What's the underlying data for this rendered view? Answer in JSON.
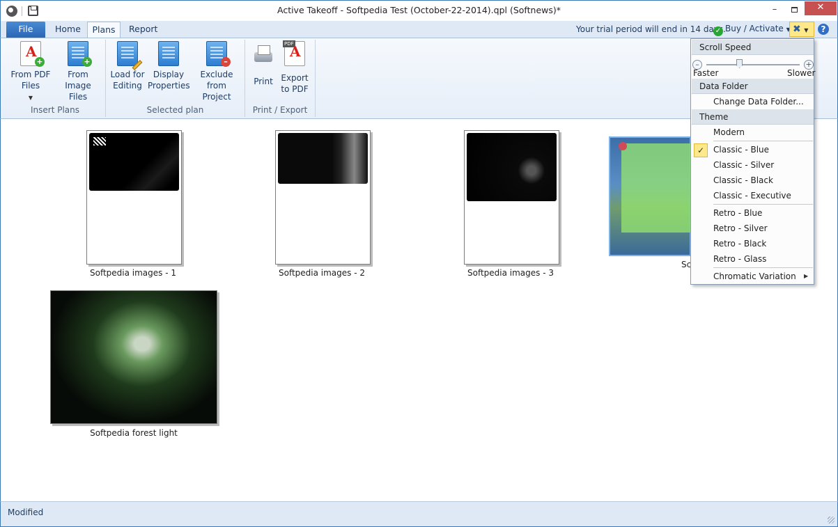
{
  "window": {
    "title": "Active Takeoff - Softpedia Test (October-22-2014).qpl (Softnews)*"
  },
  "tabs": [
    {
      "label": "File"
    },
    {
      "label": "Home"
    },
    {
      "label": "Plans"
    },
    {
      "label": "Report"
    }
  ],
  "trial_text": "Your trial period will end in 14 days.",
  "buy_label": "Buy / Activate",
  "ribbon": {
    "groups": [
      {
        "label": "Insert Plans",
        "buttons": [
          {
            "l1": "From PDF",
            "l2": "Files"
          },
          {
            "l1": "From Image",
            "l2": "Files"
          }
        ]
      },
      {
        "label": "Selected plan",
        "buttons": [
          {
            "l1": "Load for",
            "l2": "Editing"
          },
          {
            "l1": "Display",
            "l2": "Properties"
          },
          {
            "l1": "Exclude from",
            "l2": "Project"
          }
        ]
      },
      {
        "label": "Print / Export",
        "buttons": [
          {
            "l1": "Print",
            "l2": ""
          },
          {
            "l1": "Export",
            "l2": "to PDF"
          }
        ]
      }
    ],
    "pdf_badge": "PDF"
  },
  "thumbnails": [
    {
      "caption": "Softpedia images - 1"
    },
    {
      "caption": "Softpedia images - 2"
    },
    {
      "caption": "Softpedia images - 3"
    },
    {
      "caption": "Sc"
    },
    {
      "caption": "Softpedia forest light"
    }
  ],
  "status": {
    "text": "Modified"
  },
  "menu": {
    "scroll_speed": "Scroll Speed",
    "faster": "Faster",
    "slower": "Slower",
    "data_folder": "Data Folder",
    "change_data_folder": "Change Data Folder...",
    "theme": "Theme",
    "themes": [
      "Modern",
      "Classic - Blue",
      "Classic - Silver",
      "Classic - Black",
      "Classic - Executive",
      "Retro - Blue",
      "Retro - Silver",
      "Retro - Black",
      "Retro - Glass",
      "Chromatic Variation"
    ],
    "selected_theme": "Classic - Blue"
  },
  "colors": {
    "accent": "#2b66b6",
    "highlight": "#fde98a",
    "frame": "#3c78b5"
  }
}
